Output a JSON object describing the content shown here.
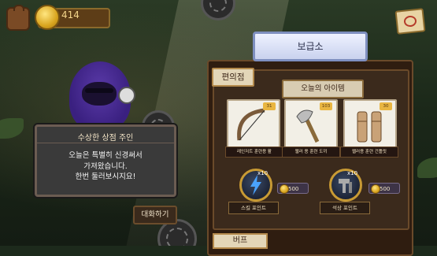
{
  "hud": {
    "gold": "414"
  },
  "shop": {
    "title": "보급소",
    "section_title": "편의점",
    "today_label": "오늘의 아이템",
    "items": [
      {
        "name": "레인저트 훈련용 활",
        "level_badge": "31"
      },
      {
        "name": "웹러 용 훈련 도끼",
        "level_badge": "103"
      },
      {
        "name": "웹러용 훈련 건틀릿",
        "level_badge": "30"
      }
    ],
    "skills": [
      {
        "label": "스킬 포인트",
        "multiplier": "x10",
        "price": "500"
      },
      {
        "label": "석상 포인트",
        "multiplier": "x10",
        "price": "500"
      }
    ],
    "buff_tab": "버프"
  },
  "dialog": {
    "title": "수상한 상점 주인",
    "lines": [
      "오늘은 특별히 신경써서",
      "가져왔습니다.",
      "한번 둘러보시지요!"
    ]
  },
  "talk_button": "대화하기",
  "colors": {
    "accent_gold": "#c89a34",
    "panel_bg": "#3b2a1c",
    "title_bg": "#eef2ff"
  }
}
